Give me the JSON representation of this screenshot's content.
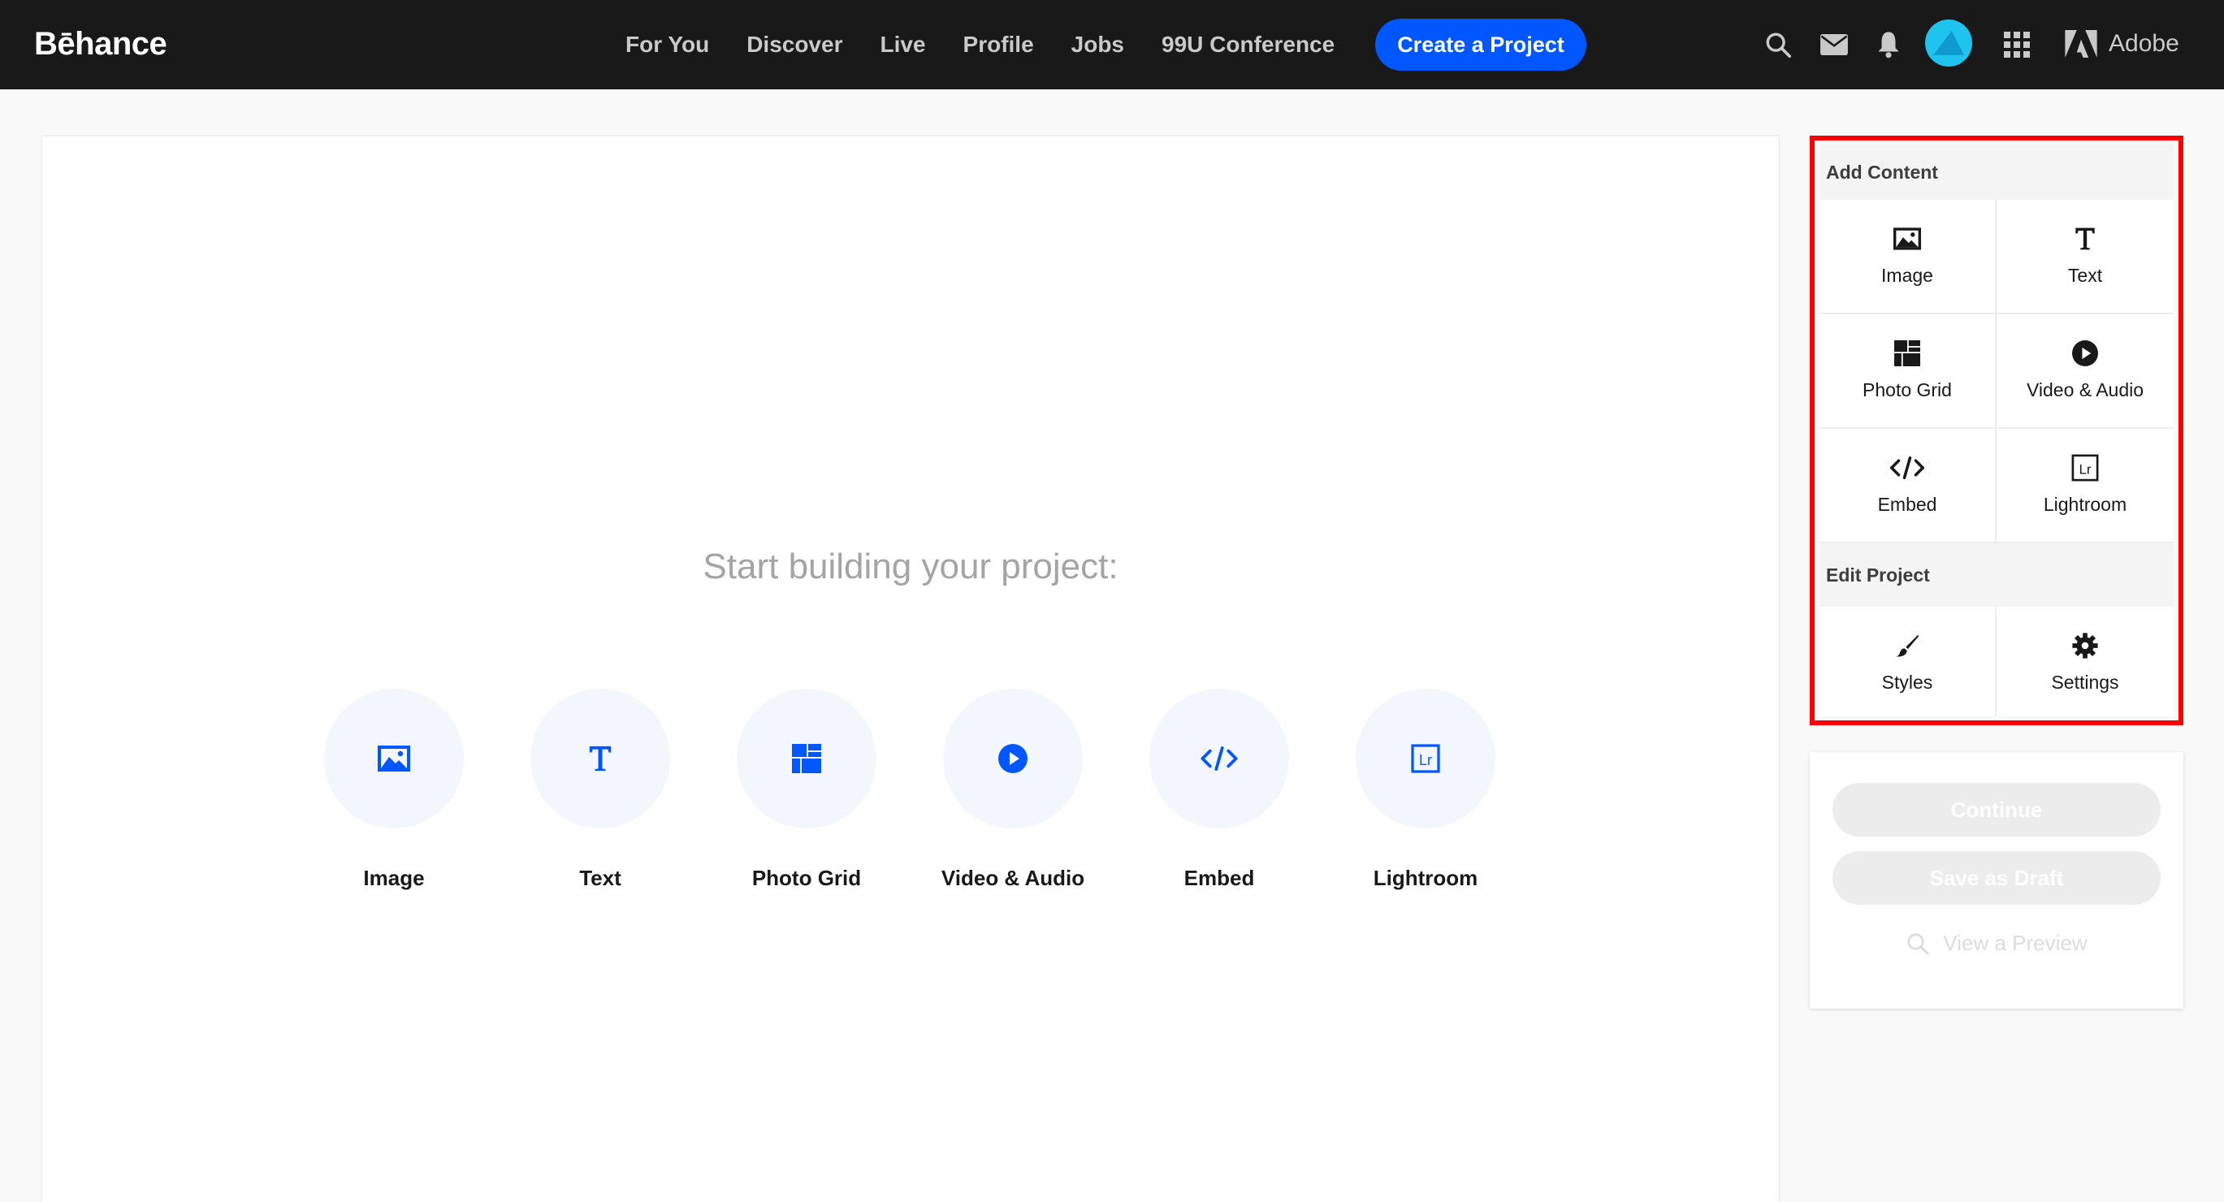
{
  "header": {
    "logo": "Bēhance",
    "nav": [
      "For You",
      "Discover",
      "Live",
      "Profile",
      "Jobs",
      "99U Conference"
    ],
    "create_label": "Create a Project",
    "adobe_label": "Adobe"
  },
  "canvas": {
    "title": "Start building your project:",
    "options": [
      {
        "label": "Image",
        "icon": "image-icon"
      },
      {
        "label": "Text",
        "icon": "text-icon"
      },
      {
        "label": "Photo Grid",
        "icon": "photo-grid-icon"
      },
      {
        "label": "Video & Audio",
        "icon": "video-audio-icon"
      },
      {
        "label": "Embed",
        "icon": "embed-icon"
      },
      {
        "label": "Lightroom",
        "icon": "lightroom-icon"
      }
    ]
  },
  "panel": {
    "add_content_title": "Add Content",
    "add_content": [
      {
        "label": "Image",
        "icon": "image-icon"
      },
      {
        "label": "Text",
        "icon": "text-icon"
      },
      {
        "label": "Photo Grid",
        "icon": "photo-grid-icon"
      },
      {
        "label": "Video & Audio",
        "icon": "video-audio-icon"
      },
      {
        "label": "Embed",
        "icon": "embed-icon"
      },
      {
        "label": "Lightroom",
        "icon": "lightroom-icon"
      }
    ],
    "edit_project_title": "Edit Project",
    "edit_project": [
      {
        "label": "Styles",
        "icon": "brush-icon"
      },
      {
        "label": "Settings",
        "icon": "gear-icon"
      }
    ]
  },
  "publish": {
    "continue_label": "Continue",
    "draft_label": "Save as Draft",
    "preview_label": "View a Preview"
  },
  "colors": {
    "accent": "#0057ff",
    "topbar": "#191919",
    "highlight": "#ff0000"
  }
}
